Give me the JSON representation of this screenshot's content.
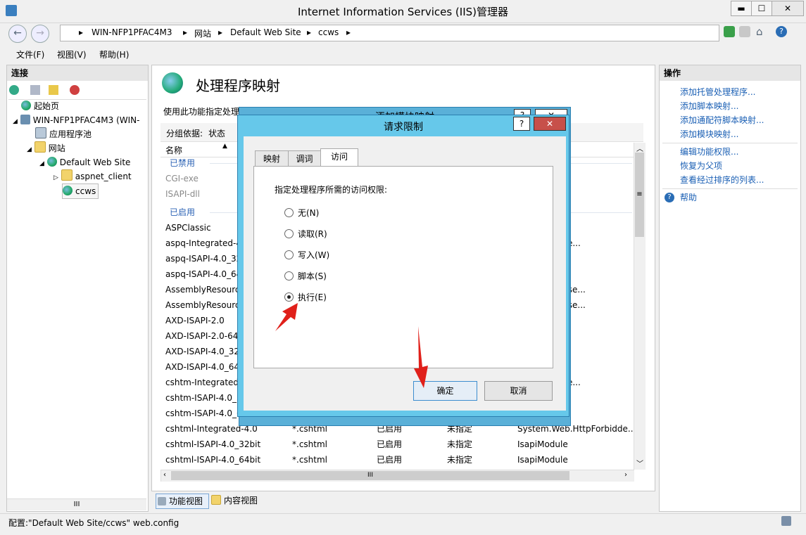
{
  "window": {
    "title": "Internet Information Services (IIS)管理器",
    "min": "▬",
    "max": "☐",
    "close": "✕"
  },
  "address": {
    "crumbs": [
      "WIN-NFP1PFAC4M3",
      "网站",
      "Default Web Site",
      "ccws"
    ]
  },
  "menu": {
    "file": "文件(F)",
    "view": "视图(V)",
    "help": "帮助(H)"
  },
  "connections": {
    "title": "连接",
    "tree": [
      {
        "label": "起始页",
        "icon": "start-page-icon"
      },
      {
        "label": "WIN-NFP1PFAC4M3 (WIN-",
        "icon": "server-icon"
      },
      {
        "label": "应用程序池",
        "icon": "app-pool-icon"
      },
      {
        "label": "网站",
        "icon": "sites-folder-icon"
      },
      {
        "label": "Default Web Site",
        "icon": "globe-icon"
      },
      {
        "label": "aspnet_client",
        "icon": "folder-icon"
      },
      {
        "label": "ccws",
        "icon": "globe-icon"
      }
    ]
  },
  "feature": {
    "title": "处理程序映射",
    "description": "使用此功能指定处理",
    "group_label": "分组依据:",
    "group_value": "状态",
    "col_name": "名称",
    "groups": {
      "disabled": "已禁用",
      "enabled": "已启用"
    },
    "disabled_rows": [
      "CGI-exe",
      "ISAPI-dll"
    ],
    "rows": [
      {
        "name": "ASPClassic",
        "path": "",
        "state": "",
        "type": "",
        "handler": ""
      },
      {
        "name": "aspq-Integrated-4",
        "path": "",
        "state": "",
        "type": "",
        "handler": "HttpForbidde..."
      },
      {
        "name": "aspq-ISAPI-4.0_32",
        "path": "",
        "state": "",
        "type": "",
        "handler": ""
      },
      {
        "name": "aspq-ISAPI-4.0_64",
        "path": "",
        "state": "",
        "type": "",
        "handler": ""
      },
      {
        "name": "AssemblyResourc",
        "path": "",
        "state": "",
        "type": "",
        "handler": "Handlers.Asse..."
      },
      {
        "name": "AssemblyResourc",
        "path": "",
        "state": "",
        "type": "",
        "handler": "Handlers.Asse..."
      },
      {
        "name": "AXD-ISAPI-2.0",
        "path": "",
        "state": "",
        "type": "",
        "handler": ""
      },
      {
        "name": "AXD-ISAPI-2.0-64",
        "path": "",
        "state": "",
        "type": "",
        "handler": ""
      },
      {
        "name": "AXD-ISAPI-4.0_32",
        "path": "",
        "state": "",
        "type": "",
        "handler": ""
      },
      {
        "name": "AXD-ISAPI-4.0_64",
        "path": "",
        "state": "",
        "type": "",
        "handler": ""
      },
      {
        "name": "cshtm-Integrated-",
        "path": "",
        "state": "",
        "type": "",
        "handler": "HttpForbidde..."
      },
      {
        "name": "cshtm-ISAPI-4.0_3",
        "path": "",
        "state": "",
        "type": "",
        "handler": ""
      },
      {
        "name": "cshtm-ISAPI-4.0_6",
        "path": "",
        "state": "",
        "type": "",
        "handler": ""
      },
      {
        "name": "cshtml-Integrated-4.0",
        "path": "*.cshtml",
        "state": "已启用",
        "type": "未指定",
        "handler": "System.Web.HttpForbidde..."
      },
      {
        "name": "cshtml-ISAPI-4.0_32bit",
        "path": "*.cshtml",
        "state": "已启用",
        "type": "未指定",
        "handler": "IsapiModule"
      },
      {
        "name": "cshtml-ISAPI-4.0_64bit",
        "path": "*.cshtml",
        "state": "已启用",
        "type": "未指定",
        "handler": "IsapiModule"
      }
    ],
    "hscroll": "III",
    "vscroll": "≡"
  },
  "bottom_tabs": {
    "features": "功能视图",
    "content": "内容视图"
  },
  "actions": {
    "title": "操作",
    "items": [
      "添加托管处理程序...",
      "添加脚本映射...",
      "添加通配符脚本映射...",
      "添加模块映射..."
    ],
    "items2": [
      "编辑功能权限...",
      "恢复为父项",
      "查看经过排序的列表..."
    ],
    "help": "帮助"
  },
  "back_dialog": {
    "title": "添加模块映射",
    "help": "?",
    "close": "✕"
  },
  "dialog": {
    "title": "请求限制",
    "help": "?",
    "close": "✕",
    "tabs": [
      "映射",
      "调词",
      "访问"
    ],
    "prompt": "指定处理程序所需的访问权限:",
    "options": [
      "无(N)",
      "读取(R)",
      "写入(W)",
      "脚本(S)",
      "执行(E)"
    ],
    "selected_index": 4,
    "ok": "确定",
    "cancel": "取消"
  },
  "status": {
    "text": "配置:\"Default Web Site/ccws\" web.config"
  },
  "tree_hscroll": "III"
}
